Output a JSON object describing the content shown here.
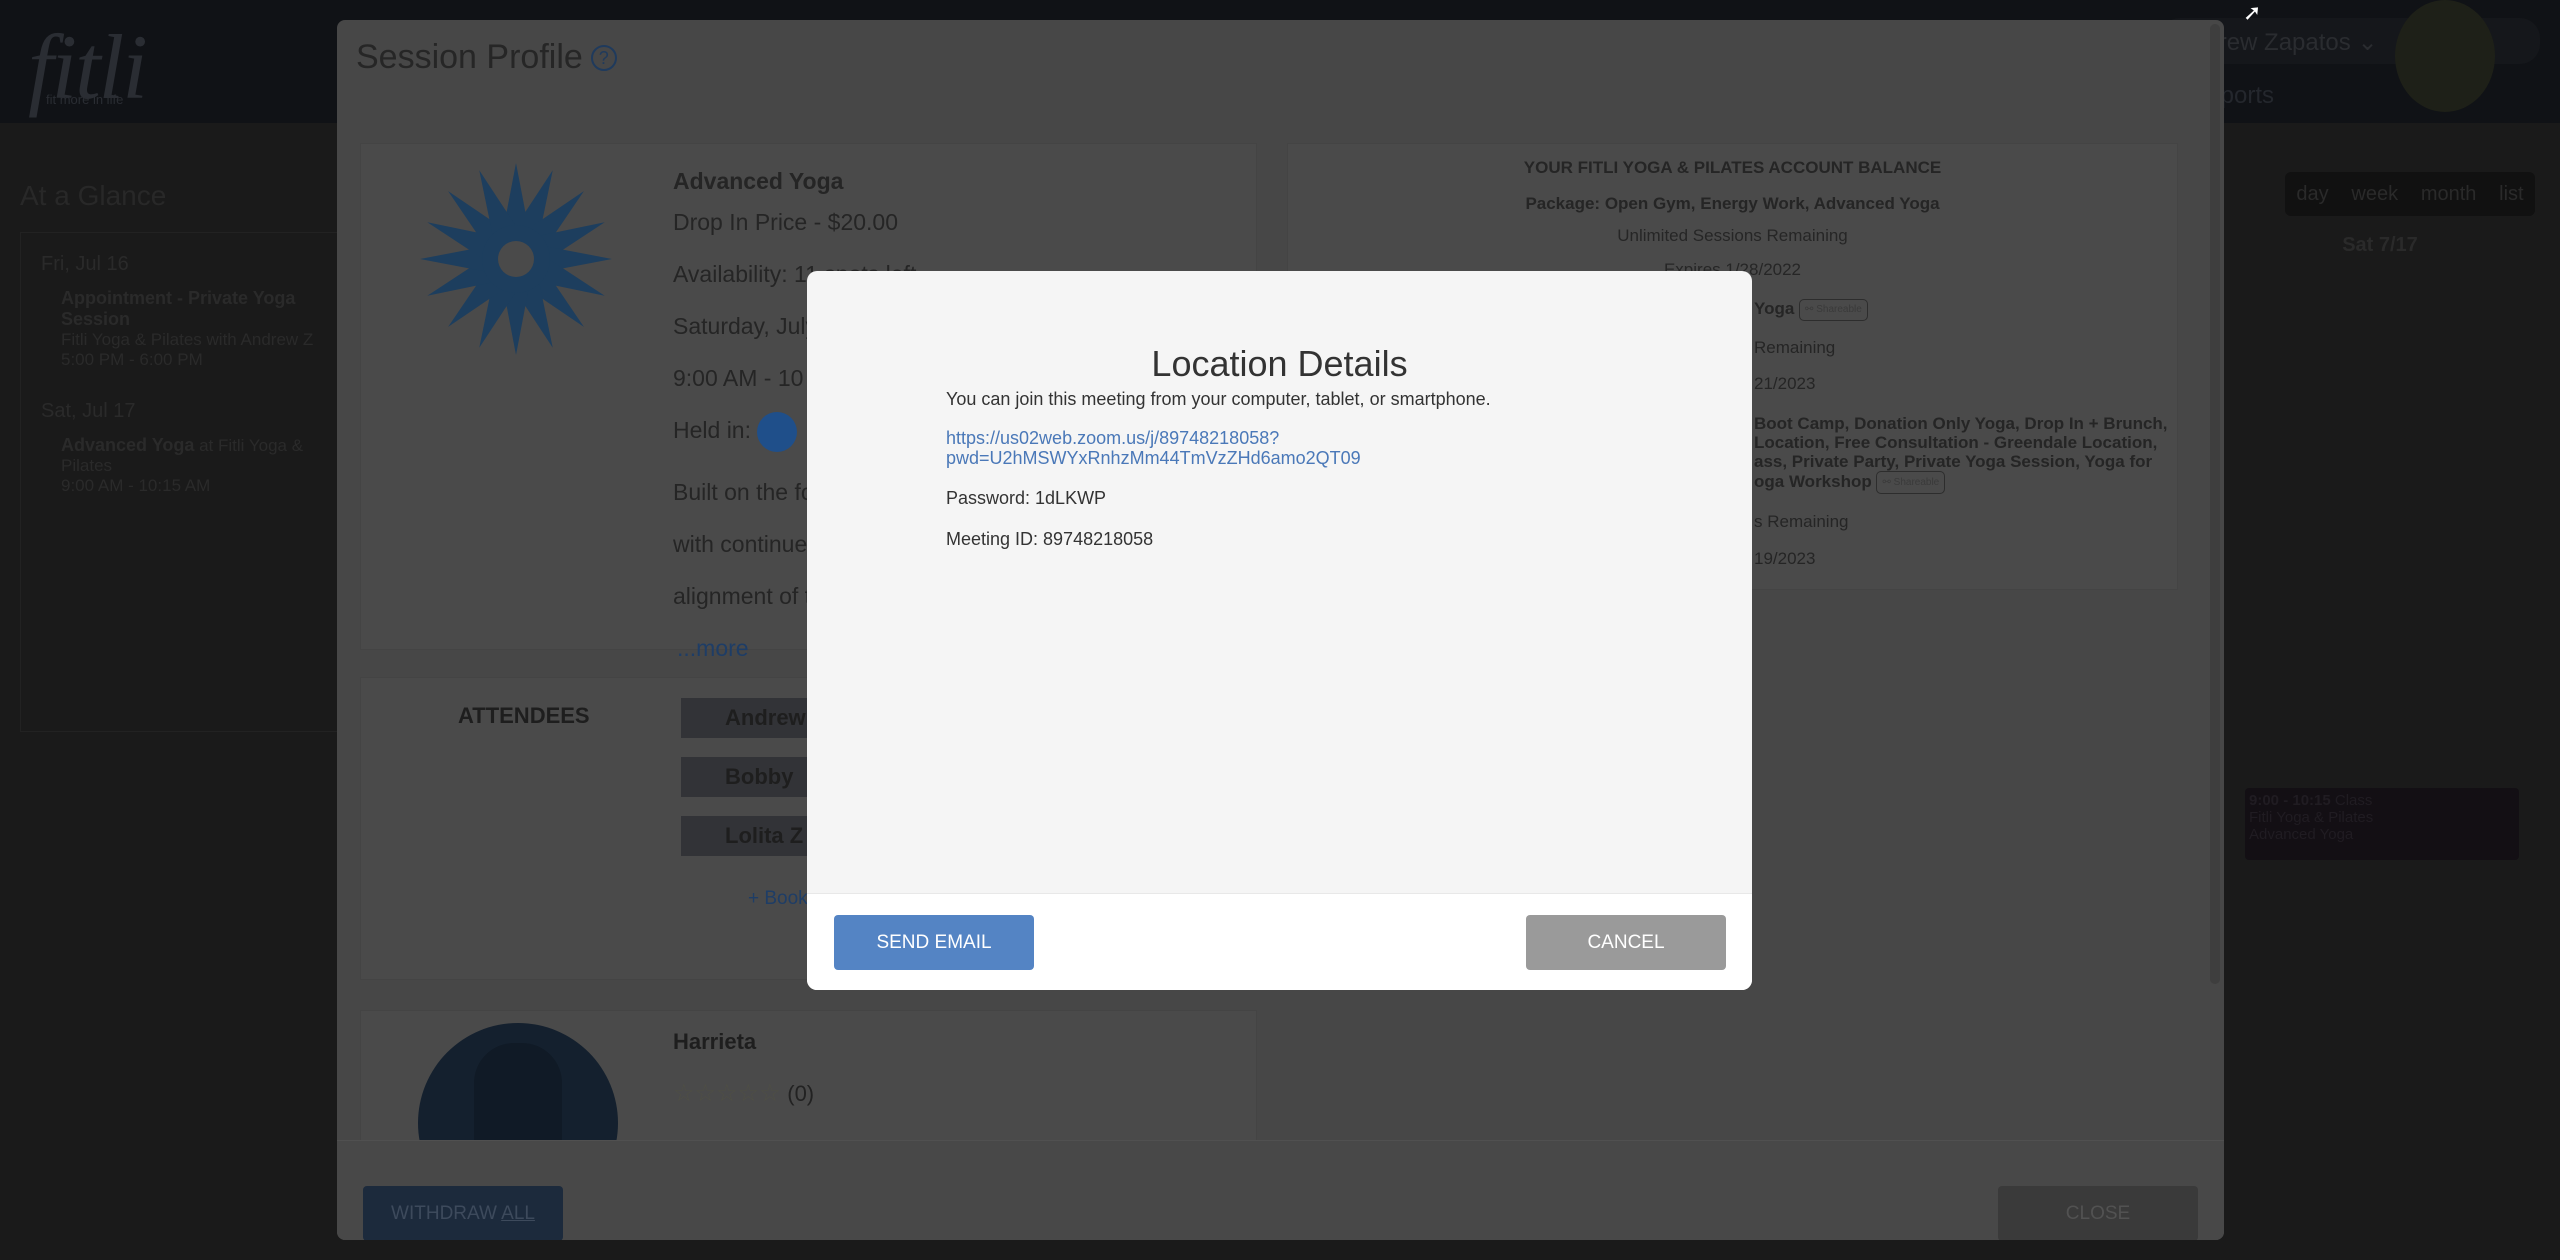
{
  "header": {
    "logo": "fitli",
    "logo_tagline": "fit more in life",
    "user_name": "Andrew Zapatos",
    "nav_item": "Reports"
  },
  "at_a_glance": {
    "title": "At a Glance",
    "days": [
      {
        "date": "Fri, Jul 16",
        "event_title": "Appointment - Private Yoga Session",
        "event_sub": "Fitli Yoga & Pilates with Andrew Z",
        "time": "5:00 PM - 6:00 PM"
      },
      {
        "date": "Sat, Jul 17",
        "event_title": "Advanced Yoga",
        "event_sub": " at Fitli Yoga & Pilates",
        "time": "9:00 AM - 10:15 AM"
      }
    ]
  },
  "calendar": {
    "views": [
      "day",
      "week",
      "month",
      "list"
    ],
    "active_view": "week",
    "day_header": "Sat 7/17",
    "event": {
      "time": "9:00 - 10:15",
      "type": "Class",
      "org": "Fitli Yoga & Pilates",
      "name": "Advanced Yoga"
    }
  },
  "session_profile": {
    "title": "Session Profile",
    "help_icon": "?",
    "session": {
      "name": "Advanced Yoga",
      "price": "Drop In Price - $20.00",
      "availability": "Availability: 11 spots left",
      "date": "Saturday, July",
      "time": "9:00 AM - 10",
      "held_in": "Held in:",
      "desc": [
        "Built on the fo",
        "with continued",
        "alignment of t"
      ],
      "more": "...more"
    },
    "balance": {
      "title": "YOUR FITLI YOGA & PILATES ACCOUNT BALANCE",
      "package1": "Package: Open Gym, Energy Work, Advanced Yoga",
      "package1_remaining": "Unlimited Sessions Remaining",
      "package1_expires": "Expires 1/28/2022",
      "package2_frag": "Yoga",
      "shareable": "Shareable",
      "package2_remaining_frag": "Remaining",
      "package2_expires_frag": "21/2023",
      "package3_frags": [
        "Boot Camp, Donation Only Yoga, Drop In + Brunch,",
        "Location, Free Consultation - Greendale Location,",
        "ass, Private Party, Private Yoga Session, Yoga for",
        "oga Workshop"
      ],
      "package3_remaining_frag": "s Remaining",
      "package3_expires_frag": "19/2023"
    },
    "attendees": {
      "label": "ATTENDEES",
      "names": [
        "Andrew",
        "Bobby",
        "Lolita Z"
      ],
      "book_link": "+ Book"
    },
    "instructor": {
      "name": "Harrieta",
      "rating_count": "(0)",
      "rating": 0,
      "max_rating": 5
    },
    "withdraw_label": "WITHDRAW ",
    "withdraw_label_underlined": "ALL",
    "close_label": "CLOSE"
  },
  "location_modal": {
    "title": "Location Details",
    "intro": "You can join this meeting from your computer, tablet, or smartphone.",
    "link_line1": "https://us02web.zoom.us/j/89748218058?",
    "link_line2": "pwd=U2hMSWYxRnhzMm44TmVzZHd6amo2QT09",
    "password": "Password: 1dLKWP",
    "meeting_id": "Meeting ID: 89748218058",
    "send_email_label": "SEND EMAIL",
    "cancel_label": "CANCEL"
  },
  "colors": {
    "primary": "#5484c4",
    "cancel": "#9a9a9a",
    "link": "#4a78b8"
  }
}
